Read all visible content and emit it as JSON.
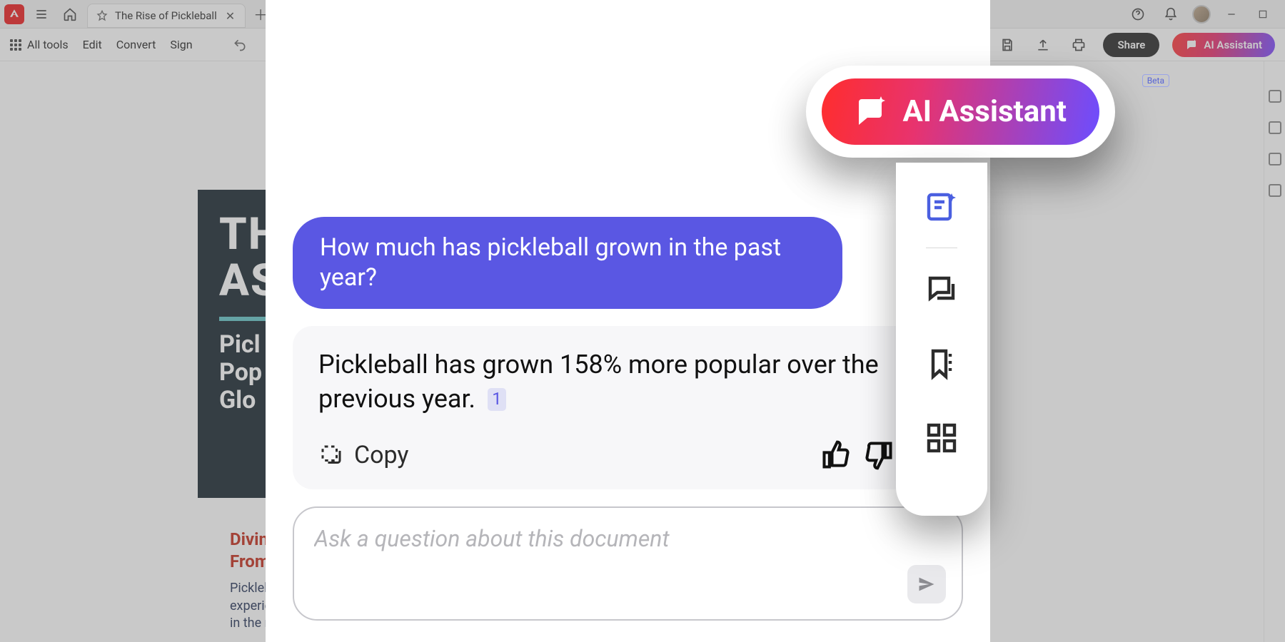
{
  "tab": {
    "title": "The Rise of Pickleball"
  },
  "toolbar": {
    "all_tools": "All tools",
    "edit": "Edit",
    "convert": "Convert",
    "sign": "Sign",
    "share": "Share",
    "ai_assistant": "AI Assistant"
  },
  "beta_label": "Beta",
  "doc": {
    "title_line1": "TH",
    "title_line2": "AS",
    "sub": "Picl\nPop\nGlo",
    "section_heading": "Divin\nFrom",
    "section_body": "Pickleba\nexperie\nin the m"
  },
  "assistant": {
    "pill_label": "AI Assistant",
    "user_message": "How much has pickleball grown in the past year?",
    "ai_message": "Pickleball has grown 158% more popular over the previous year.",
    "citation": "1",
    "copy_label": "Copy",
    "input_placeholder": "Ask a question about this document"
  }
}
